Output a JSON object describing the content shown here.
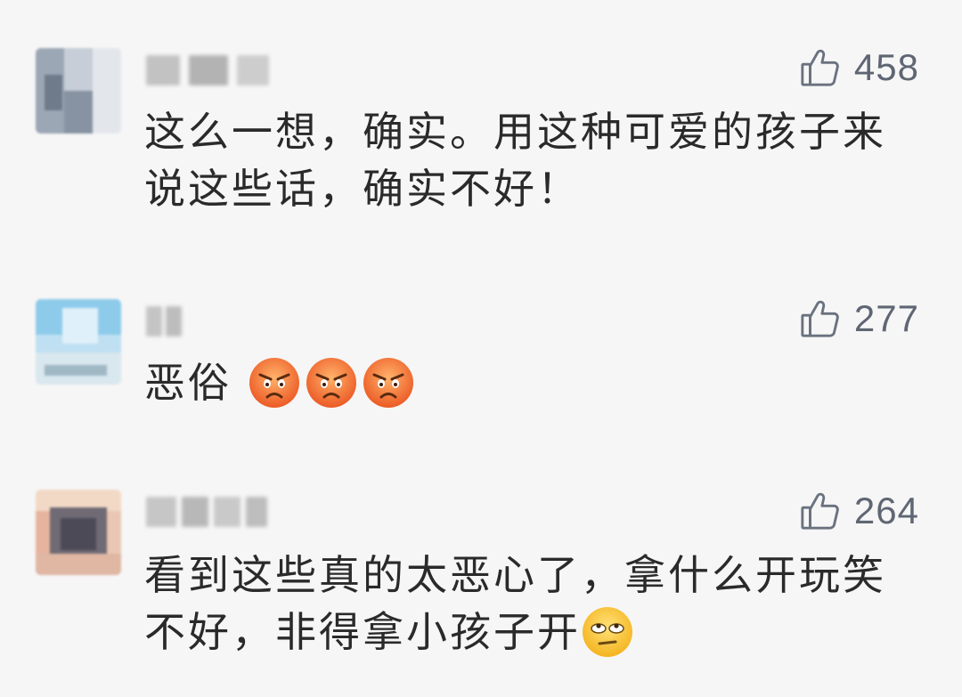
{
  "comments": [
    {
      "likes": "458",
      "text": "这么一想，确实。用这种可爱的孩子来说这些话，确实不好！",
      "avatar_icon": "blurred-avatar-icon",
      "like_icon": "thumbs-up-icon"
    },
    {
      "likes": "277",
      "text": "恶俗",
      "emojis": [
        "angry-face-icon",
        "angry-face-icon",
        "angry-face-icon"
      ],
      "avatar_icon": "blurred-avatar-icon",
      "like_icon": "thumbs-up-icon"
    },
    {
      "likes": "264",
      "text": "看到这些真的太恶心了，拿什么开玩笑不好，非得拿小孩子开",
      "emojis": [
        "eye-roll-face-icon"
      ],
      "avatar_icon": "blurred-avatar-icon",
      "like_icon": "thumbs-up-icon"
    }
  ],
  "colors": {
    "background": "#f6f6f6",
    "text": "#2a2a2a",
    "like": "#5f6673",
    "emoji_angry": "#f0642e",
    "emoji_roll": "#f9c52a"
  }
}
